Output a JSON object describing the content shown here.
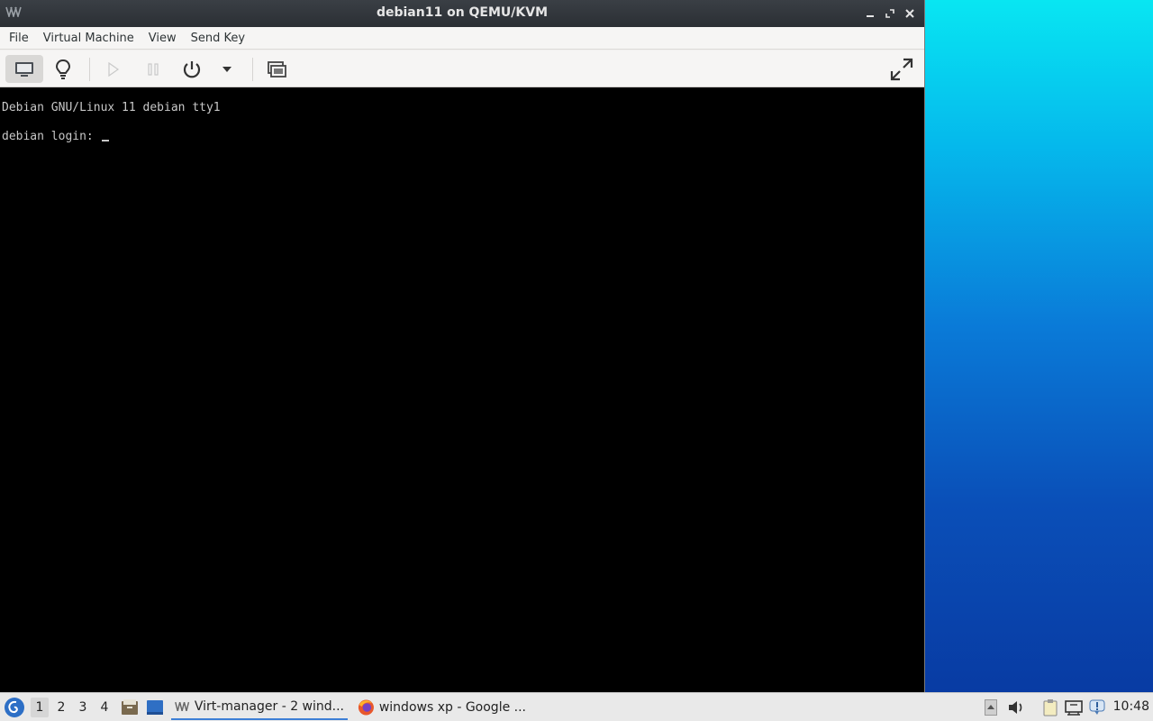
{
  "window": {
    "title": "debian11 on QEMU/KVM",
    "app_icon": "virt-manager-icon"
  },
  "menubar": {
    "items": [
      {
        "label": "File"
      },
      {
        "label": "Virtual Machine"
      },
      {
        "label": "View"
      },
      {
        "label": "Send Key"
      }
    ]
  },
  "toolbar": {
    "buttons": [
      "show-console-icon",
      "details-lightbulb-icon",
      "run-icon",
      "pause-icon",
      "power-icon",
      "power-menu-chevron-icon",
      "snapshots-icon",
      "fullscreen-icon"
    ]
  },
  "console": {
    "line1": "Debian GNU/Linux 11 debian tty1",
    "line2": "debian login: "
  },
  "taskbar": {
    "desktops": [
      "1",
      "2",
      "3",
      "4"
    ],
    "tasks": [
      {
        "label": "Virt-manager - 2 wind...",
        "icon": "virt-manager-icon"
      },
      {
        "label": "windows xp - Google ...",
        "icon": "firefox-icon"
      }
    ],
    "clock": "10:48"
  },
  "colors": {
    "titlebar": "#2b2f34",
    "console_bg": "#000000",
    "taskbar": "#e9e9e9",
    "accent": "#3d7fd6"
  }
}
